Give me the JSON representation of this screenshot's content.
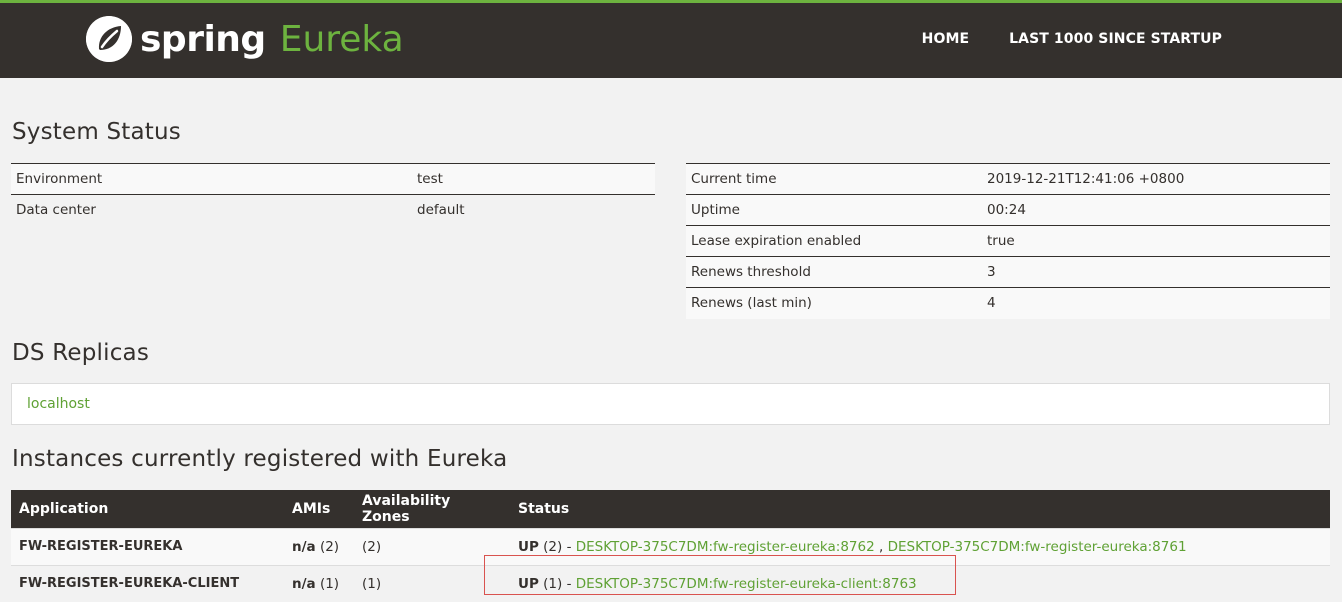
{
  "header": {
    "brand": "spring",
    "product": "Eureka",
    "nav": [
      {
        "label": "HOME"
      },
      {
        "label": "LAST 1000 SINCE STARTUP"
      }
    ]
  },
  "system_status": {
    "title": "System Status",
    "left": [
      {
        "key": "Environment",
        "value": "test"
      },
      {
        "key": "Data center",
        "value": "default"
      }
    ],
    "right": [
      {
        "key": "Current time",
        "value": "2019-12-21T12:41:06 +0800"
      },
      {
        "key": "Uptime",
        "value": "00:24"
      },
      {
        "key": "Lease expiration enabled",
        "value": "true"
      },
      {
        "key": "Renews threshold",
        "value": "3"
      },
      {
        "key": "Renews (last min)",
        "value": "4"
      }
    ]
  },
  "replicas": {
    "title": "DS Replicas",
    "items": [
      "localhost"
    ]
  },
  "instances": {
    "title": "Instances currently registered with Eureka",
    "columns": [
      "Application",
      "AMIs",
      "Availability Zones",
      "Status"
    ],
    "rows": [
      {
        "application": "FW-REGISTER-EUREKA",
        "amis_label": "n/a",
        "amis_count": "(2)",
        "zones": "(2)",
        "status": "UP",
        "status_count": "(2) -",
        "links": [
          "DESKTOP-375C7DM:fw-register-eureka:8762",
          "DESKTOP-375C7DM:fw-register-eureka:8761"
        ],
        "separator": ","
      },
      {
        "application": "FW-REGISTER-EUREKA-CLIENT",
        "amis_label": "n/a",
        "amis_count": "(1)",
        "zones": "(1)",
        "status": "UP",
        "status_count": "(1) -",
        "links": [
          "DESKTOP-375C7DM:fw-register-eureka-client:8763"
        ]
      }
    ]
  },
  "colors": {
    "header_bg": "#34302d",
    "accent": "#6db33f",
    "link": "#5fa134",
    "highlight": "#d9534f"
  }
}
